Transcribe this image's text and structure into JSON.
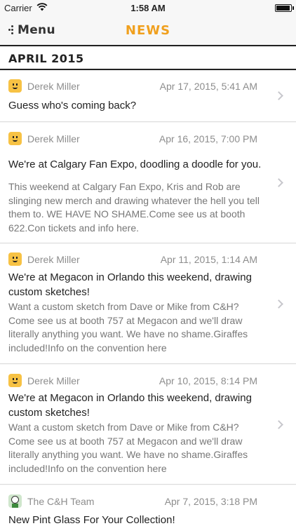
{
  "status_bar": {
    "carrier": "Carrier",
    "time": "1:58 AM"
  },
  "nav": {
    "menu_label": "Menu",
    "title": "NEWS"
  },
  "section": {
    "title": "APRIL 2015"
  },
  "posts": [
    {
      "author": "Derek Miller",
      "date": "Apr 17, 2015, 5:41 AM",
      "title": "Guess who's coming back?",
      "body": ""
    },
    {
      "author": "Derek Miller",
      "date": "Apr 16, 2015, 7:00 PM",
      "title": "We're at Calgary Fan Expo, doodling a doodle for you.",
      "body": "This weekend at Calgary Fan Expo, Kris and Rob are slinging new merch and drawing whatever the hell you tell them to. WE HAVE NO SHAME.Come see us at booth 622.Con tickets and info here."
    },
    {
      "author": "Derek Miller",
      "date": "Apr 11, 2015, 1:14 AM",
      "title": "We're at Megacon in Orlando this weekend, drawing custom sketches!",
      "body": "Want a custom sketch from Dave or Mike from C&H? Come see us at booth 757 at Megacon and we'll draw literally anything you want. We have no shame.Giraffes included!Info on the convention here"
    },
    {
      "author": "Derek Miller",
      "date": "Apr 10, 2015, 8:14 PM",
      "title": "We're at Megacon in Orlando this weekend, drawing custom sketches!",
      "body": "Want a custom sketch from Dave or Mike from C&H? Come see us at booth 757 at Megacon and we'll draw literally anything you want. We have no shame.Giraffes included!Info on the convention here"
    },
    {
      "author": "The C&H Team",
      "date": "Apr 7, 2015, 3:18 PM",
      "title": "New Pint Glass For Your Collection!",
      "body": ""
    }
  ]
}
